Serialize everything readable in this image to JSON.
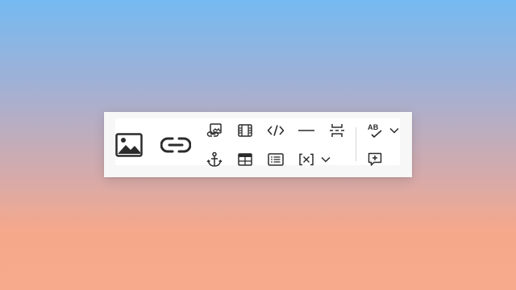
{
  "toolbar": {
    "large_buttons": [
      {
        "name": "insert-image",
        "icon": "image-icon"
      },
      {
        "name": "insert-link",
        "icon": "link-icon"
      }
    ],
    "row1": [
      {
        "name": "linked-image",
        "icon": "image-link-icon"
      },
      {
        "name": "media",
        "icon": "film-icon"
      },
      {
        "name": "code",
        "icon": "code-icon"
      },
      {
        "name": "horizontal-line",
        "icon": "horizontal-line-icon"
      },
      {
        "name": "page-break",
        "icon": "page-break-icon"
      }
    ],
    "row2": [
      {
        "name": "anchor",
        "icon": "anchor-icon"
      },
      {
        "name": "table",
        "icon": "table-icon"
      },
      {
        "name": "table-of-contents",
        "icon": "toc-icon"
      },
      {
        "name": "variables",
        "icon": "variable-icon"
      }
    ],
    "spell_check": {
      "label": "AB",
      "icon": "spell-check-icon"
    },
    "comment": {
      "icon": "add-comment-icon"
    },
    "colors": {
      "icon": "#2b2b2b",
      "panel": "#f7f7f7",
      "inner": "#ffffff",
      "divider": "#d6d6d6"
    }
  }
}
